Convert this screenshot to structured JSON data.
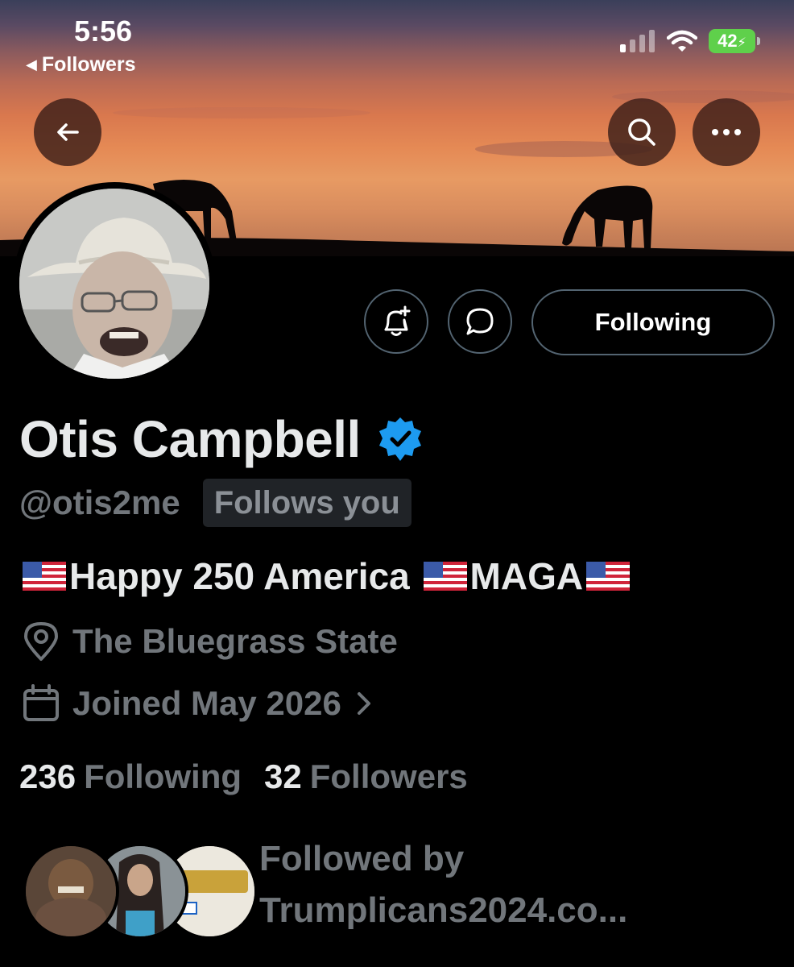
{
  "status_bar": {
    "time": "5:56",
    "back_label": "Followers",
    "battery": "42"
  },
  "nav": {
    "back_icon": "arrow-left-icon",
    "search_icon": "search-icon",
    "more_icon": "more-horizontal-icon"
  },
  "actions": {
    "notify_icon": "bell-plus-icon",
    "message_icon": "message-bubble-icon",
    "follow_label": "Following"
  },
  "profile": {
    "name": "Otis Campbell",
    "verified": true,
    "handle": "@otis2me",
    "follows_you": "Follows you",
    "bio_part1": "Happy 250 America ",
    "bio_part2": "MAGA",
    "location": "The Bluegrass State",
    "joined": "Joined May 2026"
  },
  "stats": {
    "following_count": "236",
    "following_label": "Following",
    "followers_count": "32",
    "followers_label": "Followers"
  },
  "followed_by": {
    "line1": "Followed by",
    "line2": "Trumplicans2024.co..."
  },
  "colors": {
    "accent_blue": "#1d9bf0",
    "muted": "#71767b",
    "text": "#e7e9ea",
    "battery_green": "#5fd04b"
  }
}
